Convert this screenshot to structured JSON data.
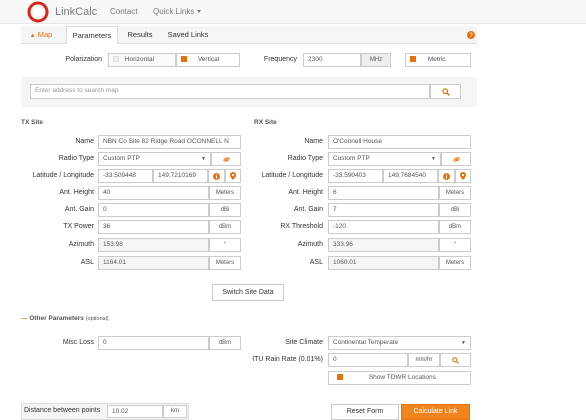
{
  "nav": {
    "brand": "LinkCalc",
    "contact": "Contact",
    "quick_links": "Quick Links"
  },
  "tabs": {
    "map": "Map",
    "parameters": "Parameters",
    "results": "Results",
    "saved_links": "Saved Links"
  },
  "polarization": {
    "label": "Polarization",
    "horizontal": "Horizontal",
    "vertical": "Vertical"
  },
  "frequency": {
    "label": "Frequency",
    "value": "2300",
    "unit": "MHz",
    "metric": "Metric"
  },
  "search": {
    "placeholder": "Enter address to search map"
  },
  "tx": {
    "title": "TX Site",
    "name_label": "Name",
    "name": "NBN Co Site 82 Ridge Road OCONNELL N",
    "radio_label": "Radio Type",
    "radio": "Custom PTP",
    "latlon_label": "Latitude / Longitude",
    "lat": "-33.509448",
    "lon": "149.7210169",
    "height_label": "Ant. Height",
    "height": "40",
    "height_unit": "Meters",
    "gain_label": "Ant. Gain",
    "gain": "0",
    "gain_unit": "dBi",
    "power_label": "TX Power",
    "power": "36",
    "power_unit": "dBm",
    "azimuth_label": "Azimuth",
    "azimuth": "153.98",
    "azimuth_unit": "°",
    "asl_label": "ASL",
    "asl": "1164.01",
    "asl_unit": "Meters"
  },
  "rx": {
    "title": "RX Site",
    "name_label": "Name",
    "name": "O'Connell House",
    "radio_label": "Radio Type",
    "radio": "Custom PTP",
    "latlon_label": "Latitude / Longitude",
    "lat": "-33.590403",
    "lon": "149.7684540",
    "height_label": "Ant. Height",
    "height": "6",
    "height_unit": "Meters",
    "gain_label": "Ant. Gain",
    "gain": "7",
    "gain_unit": "dBi",
    "threshold_label": "RX Threshold",
    "threshold": "-120",
    "threshold_unit": "dBm",
    "azimuth_label": "Azimuth",
    "azimuth": "333.96",
    "azimuth_unit": "°",
    "asl_label": "ASL",
    "asl": "1060.01",
    "asl_unit": "Meters"
  },
  "switch_label": "Switch Site Data",
  "other": {
    "title": "Other Parameters",
    "optional": "(optional)",
    "misc_loss_label": "Misc Loss",
    "misc_loss": "0",
    "misc_loss_unit": "dBm",
    "climate_label": "Site Climate",
    "climate": "Continental Temperate",
    "rain_label": "ITU Rain Rate (0.01%)",
    "rain": "0",
    "rain_unit": "mm/hr",
    "tdwr_label": "Show TDWR Locations"
  },
  "footer": {
    "distance_label": "Distance between points",
    "distance": "10.02",
    "distance_unit": "km",
    "reset": "Reset Form",
    "calculate": "Calculate Link"
  },
  "colors": {
    "accent": "#e8710a",
    "logo_red": "#d9261c"
  }
}
